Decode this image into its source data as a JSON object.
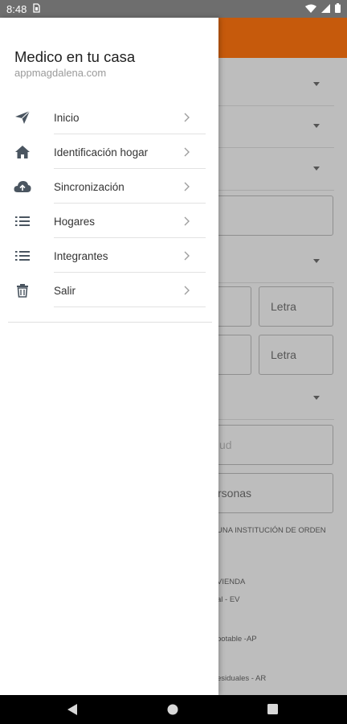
{
  "status_bar": {
    "time": "8:48",
    "left_icons": [
      "sim-icon"
    ],
    "right_icons": [
      "wifi-icon",
      "signal-icon",
      "battery-icon"
    ]
  },
  "drawer": {
    "title": "Medico en tu casa",
    "subtitle": "appmagdalena.com",
    "items": [
      {
        "label": "Inicio",
        "icon": "send-icon"
      },
      {
        "label": "Identificación hogar",
        "icon": "home-icon"
      },
      {
        "label": "Sincronización",
        "icon": "cloud-upload-icon"
      },
      {
        "label": "Hogares",
        "icon": "list-icon"
      },
      {
        "label": "Integrantes",
        "icon": "list-icon"
      },
      {
        "label": "Salir",
        "icon": "trash-icon"
      }
    ]
  },
  "background_form": {
    "letra_1": "Letra",
    "letra_2": "Letra",
    "partial_field_1": "ud",
    "partial_field_2": "rsonas",
    "text_1": "UNA INSTITUCIÓN DE ORDEN",
    "text_2": "VIENDA",
    "text_3": "al - EV",
    "text_4": "potable -AP",
    "text_5": "esiduales - AR"
  },
  "colors": {
    "toolbar": "#c65a0c",
    "drawer_bg": "#ffffff",
    "scrim": "#bdbdbd",
    "icon_color": "#4a5560"
  },
  "nav_bar": {
    "buttons": [
      "back-icon",
      "home-circle-icon",
      "recents-icon"
    ]
  }
}
